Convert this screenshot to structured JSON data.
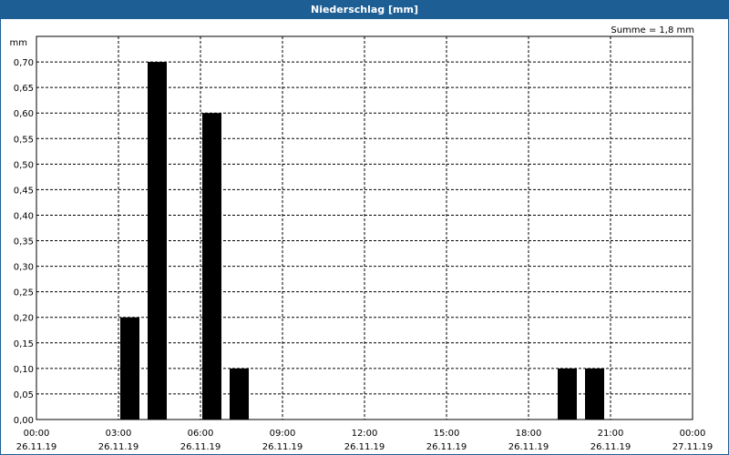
{
  "title": "Niederschlag [mm]",
  "summary": "Summe = 1,8 mm",
  "colors": {
    "header": "#1d5f95",
    "bar": "#000000",
    "grid": "#000000"
  },
  "chart_data": {
    "type": "bar",
    "title": "Niederschlag [mm]",
    "ylabel": "mm",
    "ylim": [
      0,
      0.75
    ],
    "yticks": [
      "0,00",
      "0,05",
      "0,10",
      "0,15",
      "0,20",
      "0,25",
      "0,30",
      "0,35",
      "0,40",
      "0,45",
      "0,50",
      "0,55",
      "0,60",
      "0,65",
      "0,70"
    ],
    "xlim": [
      "26.11.19 00:00",
      "27.11.19 00:00"
    ],
    "xticks": [
      {
        "time": "00:00",
        "date": "26.11.19"
      },
      {
        "time": "03:00",
        "date": "26.11.19"
      },
      {
        "time": "06:00",
        "date": "26.11.19"
      },
      {
        "time": "09:00",
        "date": "26.11.19"
      },
      {
        "time": "12:00",
        "date": "26.11.19"
      },
      {
        "time": "15:00",
        "date": "26.11.19"
      },
      {
        "time": "18:00",
        "date": "26.11.19"
      },
      {
        "time": "21:00",
        "date": "26.11.19"
      },
      {
        "time": "00:00",
        "date": "27.11.19"
      }
    ],
    "grid": true,
    "bars": [
      {
        "time": "26.11.19 03:00",
        "value": 0.2
      },
      {
        "time": "26.11.19 04:00",
        "value": 0.7
      },
      {
        "time": "26.11.19 06:00",
        "value": 0.6
      },
      {
        "time": "26.11.19 07:00",
        "value": 0.1
      },
      {
        "time": "26.11.19 19:00",
        "value": 0.1
      },
      {
        "time": "26.11.19 20:00",
        "value": 0.1
      }
    ]
  }
}
